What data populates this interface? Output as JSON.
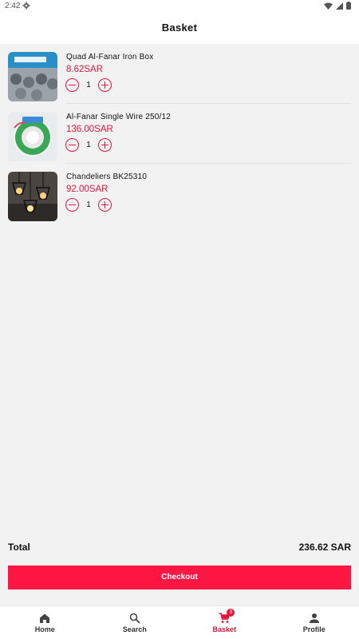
{
  "status_bar": {
    "time": "2:42"
  },
  "app_bar": {
    "title": "Basket"
  },
  "items": [
    {
      "name": "Quad Al-Fanar Iron Box",
      "price": "8.62SAR",
      "quantity": "1"
    },
    {
      "name": "Al-Fanar Single Wire 250/12",
      "price": "136.00SAR",
      "quantity": "1"
    },
    {
      "name": "Chandeliers BK25310",
      "price": "92.00SAR",
      "quantity": "1"
    }
  ],
  "summary": {
    "total_label": "Total",
    "total_value": "236.62 SAR"
  },
  "checkout": {
    "label": "Checkout"
  },
  "nav": {
    "items": [
      {
        "label": "Home",
        "icon": "home-icon"
      },
      {
        "label": "Search",
        "icon": "search-icon"
      },
      {
        "label": "Basket",
        "icon": "cart-icon",
        "badge": "3"
      },
      {
        "label": "Profile",
        "icon": "person-icon"
      }
    ]
  },
  "colors": {
    "accent": "#e8163c",
    "button": "#ff1744",
    "background": "#f2f2f2"
  }
}
